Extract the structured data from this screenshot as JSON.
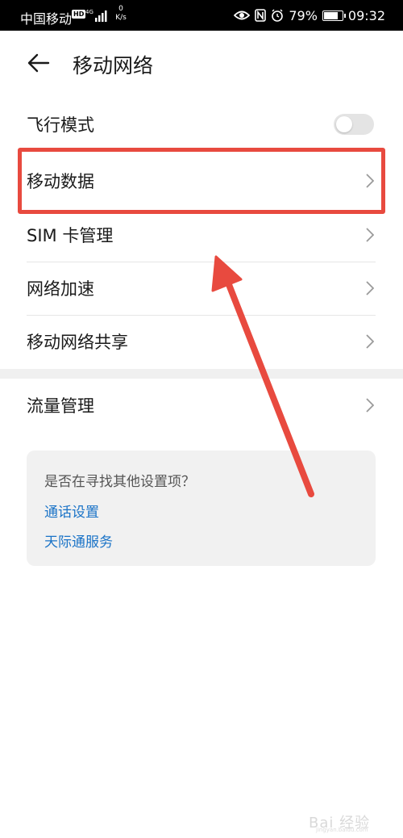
{
  "status_bar": {
    "carrier": "中国移动",
    "hd_badge": "HD",
    "network_type": "4G",
    "speed_value": "0",
    "speed_unit": "K/s",
    "battery": "79%",
    "battery_level": 0.79,
    "time": "09:32",
    "icons": [
      "eye-icon",
      "nfc-icon",
      "alarm-icon",
      "battery-icon"
    ]
  },
  "header": {
    "title": "移动网络",
    "back_icon": "arrow-left-icon"
  },
  "settings": {
    "airplane_mode": {
      "label": "飞行模式",
      "enabled": false
    },
    "mobile_data": {
      "label": "移动数据"
    },
    "sim_management": {
      "label": "SIM 卡管理"
    },
    "network_acceleration": {
      "label": "网络加速"
    },
    "hotspot": {
      "label": "移动网络共享"
    },
    "data_usage": {
      "label": "流量管理"
    }
  },
  "suggestions": {
    "question": "是否在寻找其他设置项？",
    "links": [
      "通话设置",
      "天际通服务"
    ]
  },
  "annotation": {
    "highlight_color": "#e84a3f"
  },
  "watermark": {
    "text": "Bai 经验",
    "sub": "jingyan.baidu.com"
  },
  "colors": {
    "link": "#1a73c7",
    "text": "#1a1a1a",
    "annotation": "#e84a3f"
  }
}
